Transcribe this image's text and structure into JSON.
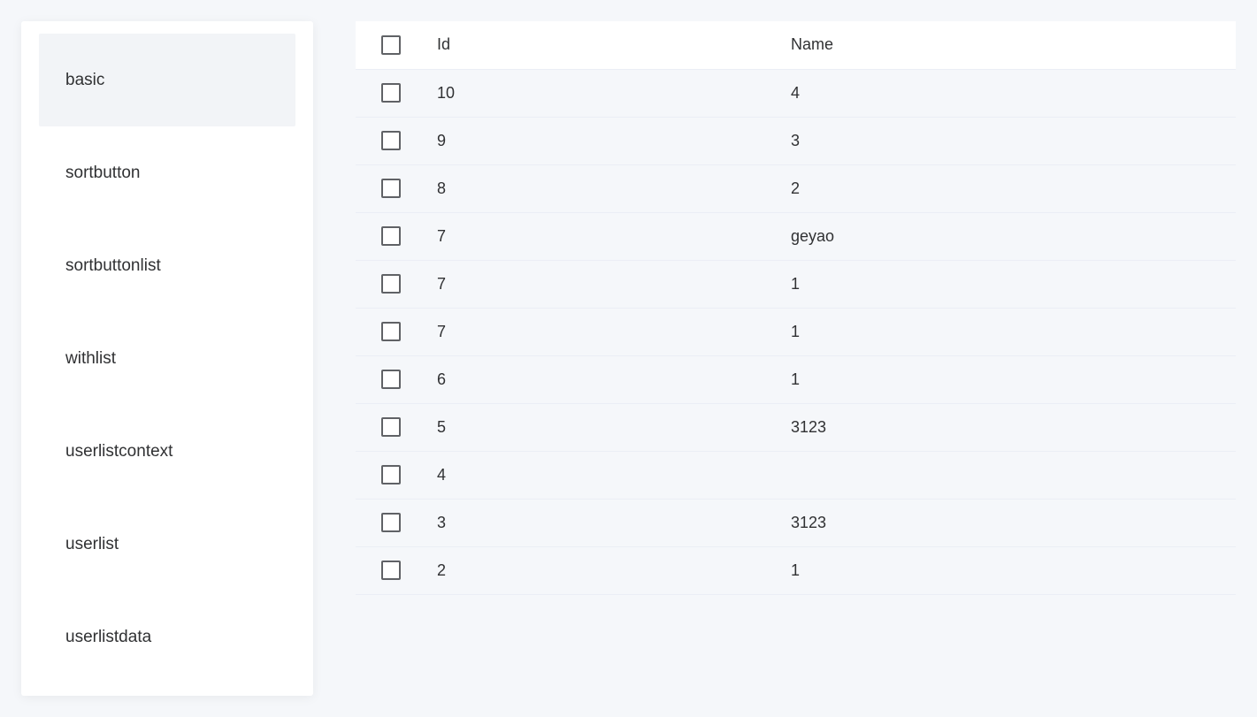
{
  "sidebar": {
    "items": [
      {
        "label": "basic",
        "active": true
      },
      {
        "label": "sortbutton",
        "active": false
      },
      {
        "label": "sortbuttonlist",
        "active": false
      },
      {
        "label": "withlist",
        "active": false
      },
      {
        "label": "userlistcontext",
        "active": false
      },
      {
        "label": "userlist",
        "active": false
      },
      {
        "label": "userlistdata",
        "active": false
      }
    ]
  },
  "table": {
    "columns": [
      "Id",
      "Name"
    ],
    "rows": [
      {
        "id": "10",
        "name": "4"
      },
      {
        "id": "9",
        "name": "3"
      },
      {
        "id": "8",
        "name": "2"
      },
      {
        "id": "7",
        "name": "geyao"
      },
      {
        "id": "7",
        "name": "1"
      },
      {
        "id": "7",
        "name": "1"
      },
      {
        "id": "6",
        "name": "1"
      },
      {
        "id": "5",
        "name": "3123"
      },
      {
        "id": "4",
        "name": ""
      },
      {
        "id": "3",
        "name": "3123"
      },
      {
        "id": "2",
        "name": "1"
      }
    ]
  }
}
